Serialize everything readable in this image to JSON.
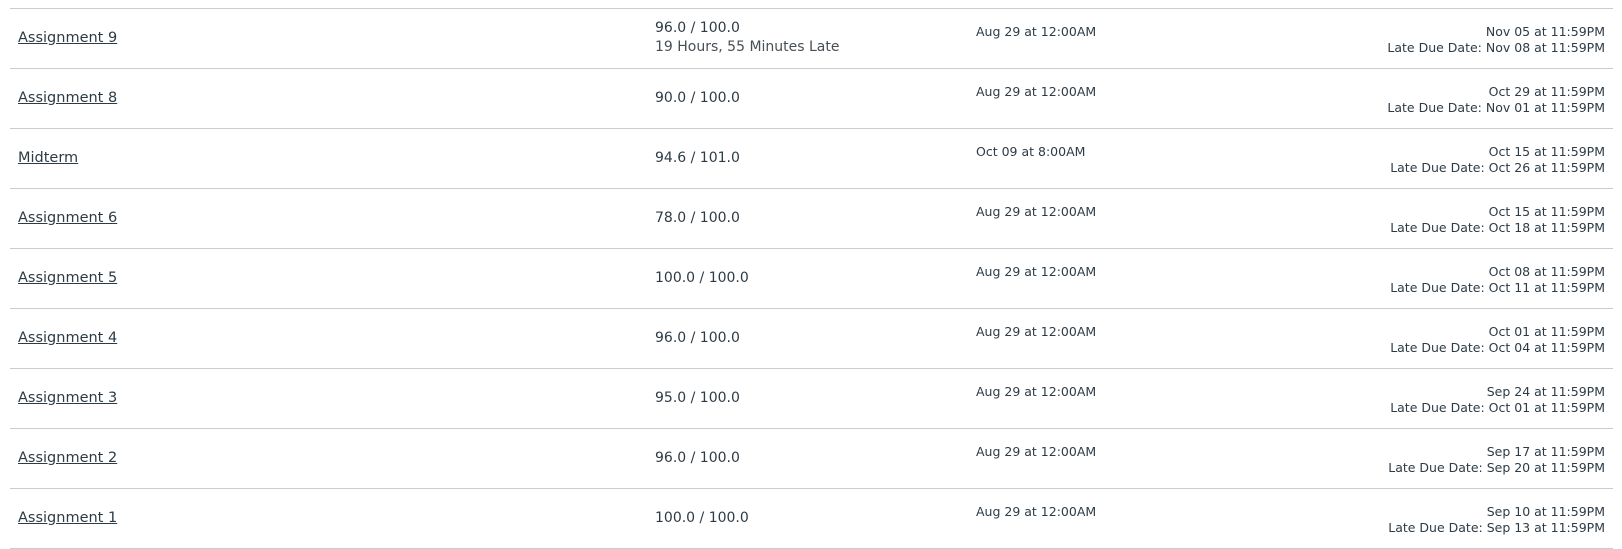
{
  "assignments": [
    {
      "title": "Assignment 9",
      "score": "96.0 / 100.0",
      "late": "19 Hours, 55 Minutes Late",
      "released": "Aug 29 at 12:00AM",
      "due": "Nov 05 at 11:59PM",
      "late_due": "Late Due Date: Nov 08 at 11:59PM"
    },
    {
      "title": "Assignment 8",
      "score": "90.0 / 100.0",
      "released": "Aug 29 at 12:00AM",
      "due": "Oct 29 at 11:59PM",
      "late_due": "Late Due Date: Nov 01 at 11:59PM"
    },
    {
      "title": "Midterm",
      "score": "94.6 / 101.0",
      "released": "Oct 09 at 8:00AM",
      "due": "Oct 15 at 11:59PM",
      "late_due": "Late Due Date: Oct 26 at 11:59PM"
    },
    {
      "title": "Assignment 6",
      "score": "78.0 / 100.0",
      "released": "Aug 29 at 12:00AM",
      "due": "Oct 15 at 11:59PM",
      "late_due": "Late Due Date: Oct 18 at 11:59PM"
    },
    {
      "title": "Assignment 5",
      "score": "100.0 / 100.0",
      "released": "Aug 29 at 12:00AM",
      "due": "Oct 08 at 11:59PM",
      "late_due": "Late Due Date: Oct 11 at 11:59PM"
    },
    {
      "title": "Assignment 4",
      "score": "96.0 / 100.0",
      "released": "Aug 29 at 12:00AM",
      "due": "Oct 01 at 11:59PM",
      "late_due": "Late Due Date: Oct 04 at 11:59PM"
    },
    {
      "title": "Assignment 3",
      "score": "95.0 / 100.0",
      "released": "Aug 29 at 12:00AM",
      "due": "Sep 24 at 11:59PM",
      "late_due": "Late Due Date: Oct 01 at 11:59PM"
    },
    {
      "title": "Assignment 2",
      "score": "96.0 / 100.0",
      "released": "Aug 29 at 12:00AM",
      "due": "Sep 17 at 11:59PM",
      "late_due": "Late Due Date: Sep 20 at 11:59PM"
    },
    {
      "title": "Assignment 1",
      "score": "100.0 / 100.0",
      "released": "Aug 29 at 12:00AM",
      "due": "Sep 10 at 11:59PM",
      "late_due": "Late Due Date: Sep 13 at 11:59PM"
    }
  ]
}
